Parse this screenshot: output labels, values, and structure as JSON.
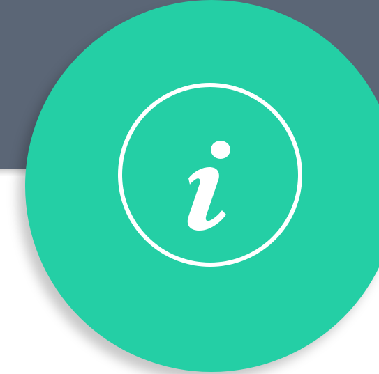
{
  "dialog": {
    "header_color": "#5b6676",
    "body_color": "#ffffff",
    "badge": {
      "color": "#24cfa5",
      "icon": "info-icon",
      "icon_color": "#ffffff"
    }
  }
}
